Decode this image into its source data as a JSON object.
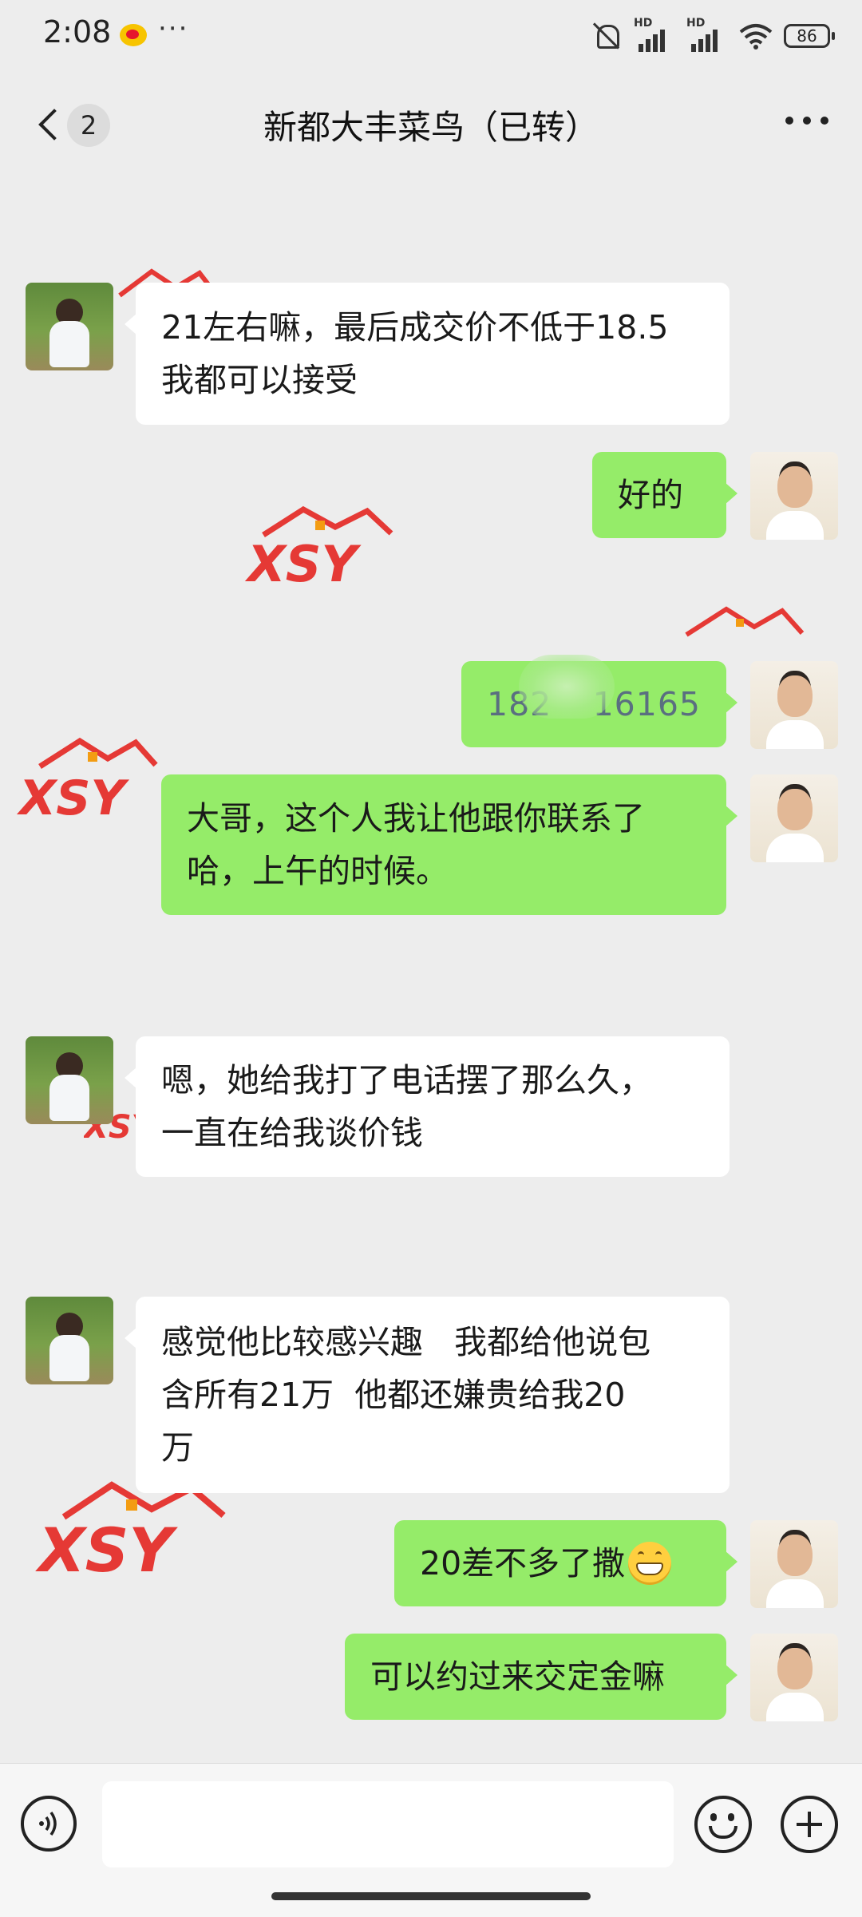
{
  "status_bar": {
    "time": "2:08",
    "more": "···",
    "signal_label_1": "HD",
    "signal_label_2": "HD",
    "battery": "86",
    "icons": [
      "weibo-icon",
      "mute-icon",
      "signal-icon",
      "signal-icon",
      "wifi-icon",
      "battery-icon"
    ]
  },
  "nav": {
    "unread_count": "2",
    "title": "新都大丰菜鸟（已转）",
    "icons": [
      "back-icon",
      "more-icon"
    ]
  },
  "watermark_text": "XSY",
  "messages": [
    {
      "side": "in",
      "text": "21左右嘛，最后成交价不低于18.5\n我都可以接受"
    },
    {
      "side": "out",
      "text": "好的"
    },
    {
      "side": "out",
      "text_visible_left": "182",
      "text_visible_right": "16165",
      "note": "partially obscured phone number"
    },
    {
      "side": "out",
      "text": "大哥，这个人我让他跟你联系了\n哈，上午的时候。"
    },
    {
      "side": "in",
      "text": "嗯，她给我打了电话摆了那么久，\n一直在给我谈价钱"
    },
    {
      "side": "in",
      "text": "感觉他比较感兴趣   我都给他说包\n含所有21万  他都还嫌贵给我20\n万"
    },
    {
      "side": "out",
      "text": "20差不多了撒",
      "emoji": "grin-emoji"
    },
    {
      "side": "out",
      "text": "可以约过来交定金嘛"
    }
  ],
  "input_bar": {
    "placeholder": "",
    "icons": [
      "voice-icon",
      "emoji-icon",
      "plus-icon"
    ]
  },
  "colors": {
    "background": "#ededed",
    "bubble_out": "#95ec69",
    "bubble_in": "#ffffff",
    "watermark": "#e53935"
  }
}
